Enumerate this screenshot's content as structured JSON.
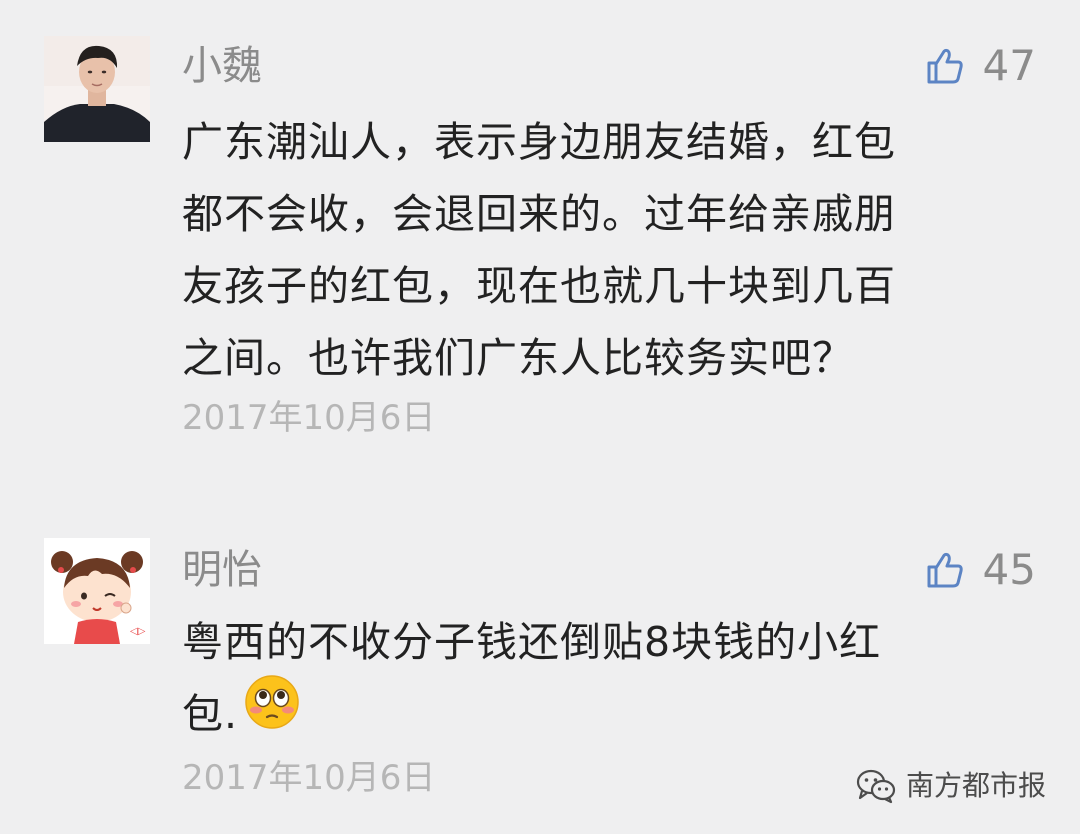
{
  "comments": [
    {
      "username": "小魏",
      "likes": "47",
      "lines": [
        "广东潮汕人，表示身边朋友结婚，红包",
        "都不会收，会退回来的。过年给亲戚朋",
        "友孩子的红包，现在也就几十块到几百",
        "之间。也许我们广东人比较务实吧？"
      ],
      "date": "2017年10月6日",
      "avatar_icon": "young-man-avatar"
    },
    {
      "username": "明怡",
      "likes": "45",
      "lines": [
        "粤西的不收分子钱还倒贴8块钱的小红",
        "包."
      ],
      "date": "2017年10月6日",
      "avatar_icon": "cartoon-girl-avatar",
      "emoji_icon": "flushed-face-emoji"
    }
  ],
  "watermark": {
    "text": "南方都市报",
    "icon": "wechat-official-account-icon"
  },
  "colors": {
    "background": "#efeff0",
    "name": "#8b8b8b",
    "text": "#222222",
    "date": "#b6b6b6",
    "like_icon": "#5c84c4"
  }
}
